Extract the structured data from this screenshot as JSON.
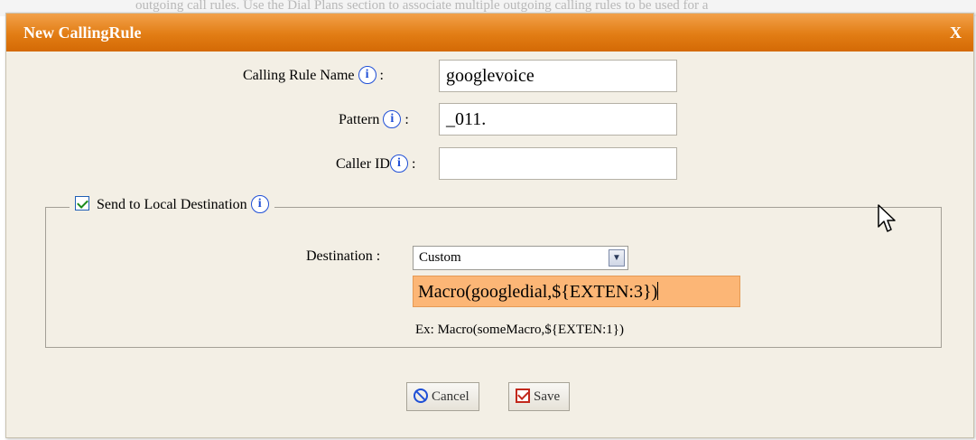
{
  "background": {
    "text": "outgoing call rules. Use the Dial Plans section to associate multiple outgoing calling rules to be used for a"
  },
  "dialog": {
    "title": "New CallingRule",
    "close_label": "X"
  },
  "form": {
    "calling_rule_name": {
      "label": "Calling Rule Name",
      "colon": ":",
      "value": "googlevoice"
    },
    "pattern": {
      "label": "Pattern",
      "colon": ":",
      "value": "_011."
    },
    "caller_id": {
      "label": "Caller ID",
      "colon": ":",
      "value": ""
    }
  },
  "local_destination": {
    "checkbox_label": "Send to Local Destination",
    "checked": true,
    "destination_label": "Destination :",
    "destination_selected": "Custom",
    "custom_value": "Macro(googledial,${EXTEN:3})",
    "hint": "Ex: Macro(someMacro,${EXTEN:1})"
  },
  "buttons": {
    "cancel_label": "Cancel",
    "save_label": "Save"
  },
  "icons": {
    "info": "info-icon",
    "info_glyph": "i",
    "dropdown_glyph": "▼"
  },
  "colors": {
    "titlebar": "#e27d14",
    "dialog_bg": "#f3efe5",
    "highlight_input": "#fcb676",
    "info_blue": "#1f4fd6"
  }
}
